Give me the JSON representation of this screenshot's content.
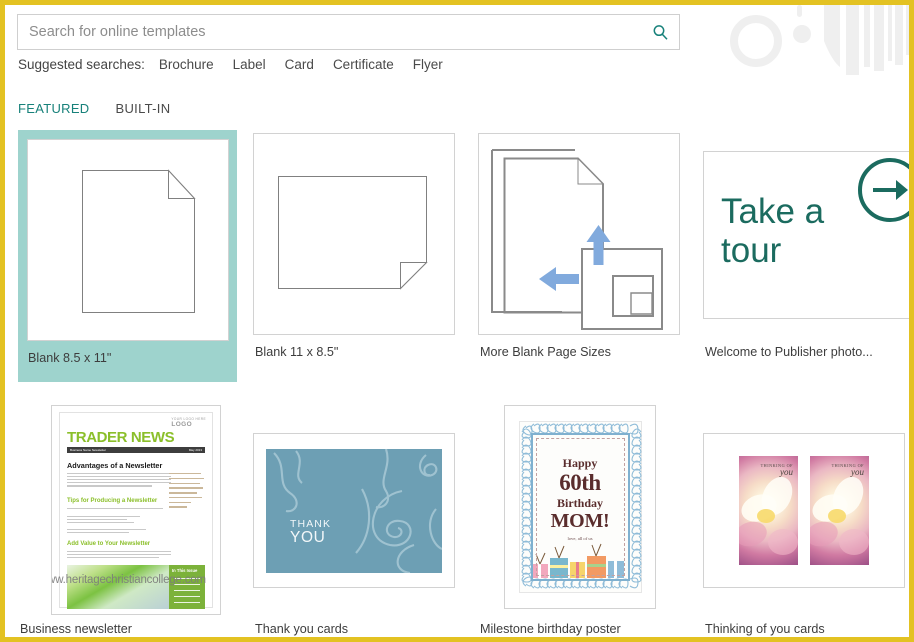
{
  "window": {
    "border_color": "#e3c222",
    "accent_teal": "#17817a",
    "selected_tile_color": "#9ed3cd"
  },
  "search": {
    "placeholder": "Search for online templates",
    "value": "",
    "icon": "search-icon"
  },
  "suggested": {
    "label": "Suggested searches:",
    "items": [
      "Brochure",
      "Label",
      "Card",
      "Certificate",
      "Flyer"
    ]
  },
  "tabs": [
    {
      "label": "FEATURED",
      "active": true
    },
    {
      "label": "BUILT-IN",
      "active": false
    }
  ],
  "templates": [
    {
      "label": "Blank 8.5 x 11\"",
      "selected": true
    },
    {
      "label": "Blank 11 x 8.5\"",
      "selected": false
    },
    {
      "label": "More Blank Page Sizes",
      "selected": false
    },
    {
      "label": "Welcome to Publisher photo...",
      "selected": false,
      "pinned_icon": "pin-icon"
    },
    {
      "label": "Business newsletter",
      "selected": false
    },
    {
      "label": "Thank you cards",
      "selected": false
    },
    {
      "label": "Milestone birthday poster",
      "selected": false
    },
    {
      "label": "Thinking of you cards",
      "selected": false
    }
  ],
  "tour_tile": {
    "line1": "Take a",
    "line2": "tour",
    "arrow_icon": "arrow-right-circle-icon",
    "color": "#1b6b5f"
  },
  "newsletter_thumb": {
    "logo": "LOGO",
    "logo_small": "YOUR LOGO HERE",
    "title": "TRADER NEWS",
    "bar_left": "Business Name Newsletter",
    "bar_right": "May 2013",
    "heading1": "Advantages of a Newsletter",
    "heading2": "Tips for Producing a Newsletter",
    "heading3": "Add Value to Your Newsletter",
    "sidebar_title": "In This Issue",
    "green_items": [
      "Advantages of a Newsletter",
      "Add Value to Your Newsletter",
      "Success Story",
      "Member Story",
      "Back Page Story"
    ]
  },
  "thankyou_thumb": {
    "line1": "THANK",
    "line2": "YOU",
    "bg": "#6d9fb4"
  },
  "birthday_thumb": {
    "line1": "Happy",
    "line2": "60th",
    "line3": "Birthday",
    "line4": "MOM!",
    "line5": "love, all of us"
  },
  "thinkingofyou_thumb": {
    "line1": "THINKING OF",
    "line2": "you"
  },
  "watermark": {
    "text": "www.heritagechristiancollege.com"
  }
}
